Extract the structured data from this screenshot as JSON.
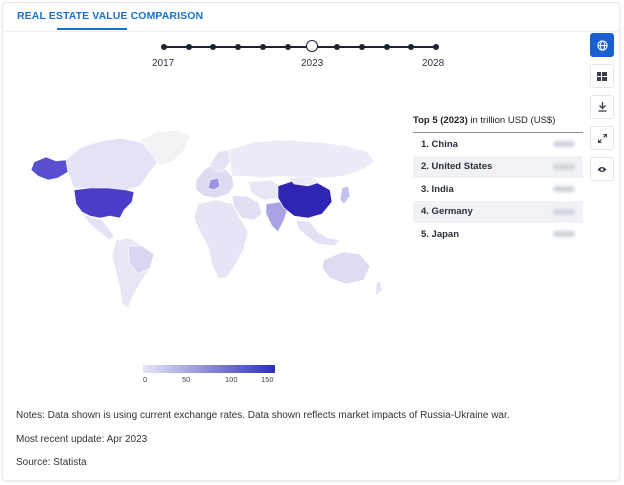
{
  "tab": {
    "label": "REAL ESTATE VALUE COMPARISON"
  },
  "timeline": {
    "start_label": "2017",
    "selected_label": "2023",
    "end_label": "2028",
    "selected_index": 6,
    "point_count": 12
  },
  "toolbar": {
    "icons": [
      "globe-icon",
      "table-icon",
      "download-icon",
      "expand-icon",
      "eye-icon"
    ],
    "active_color": "#1a5fd0"
  },
  "ranking": {
    "title_bold": "Top 5 (2023)",
    "title_rest": " in trillion USD (US$)",
    "rows": [
      {
        "label": "1. China"
      },
      {
        "label": "2. United States"
      },
      {
        "label": "3. India"
      },
      {
        "label": "4. Germany"
      },
      {
        "label": "5. Japan"
      }
    ]
  },
  "legend": {
    "ticks": [
      "0",
      "50",
      "100",
      "150"
    ],
    "low_color": "#e6e6f7",
    "high_color": "#2e2fb8"
  },
  "notes": {
    "text": "Notes: Data shown is using current exchange rates. Data shown reflects market impacts of Russia-Ukraine war.",
    "update": "Most recent update: Apr 2023",
    "source": "Source: Statista"
  }
}
